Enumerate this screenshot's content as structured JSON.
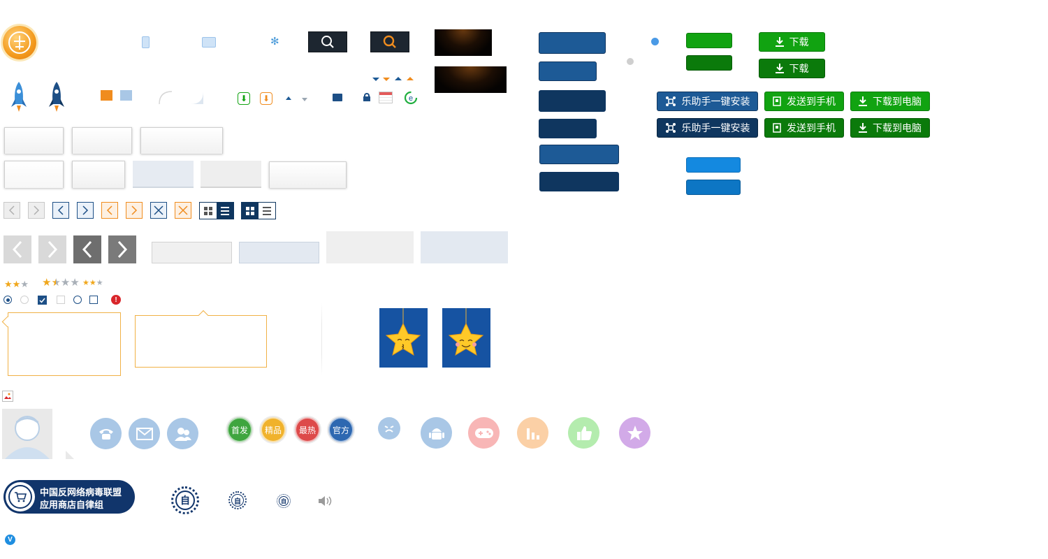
{
  "colors": {
    "navy": "#1d5a96",
    "navy_dark": "#0f365f",
    "green": "#11a311",
    "green_dark": "#0b7a0b",
    "blue_bright": "#1489e0",
    "orange": "#f08c1e",
    "page_bg": "#ffffff"
  },
  "top_icons": {
    "logo": "orange-medal-logo",
    "phone": "mobile-icon",
    "tablet": "tablet-icon",
    "settings": "gear-icon",
    "search": "search-icon"
  },
  "download_buttons": {
    "download_label": "下载",
    "download_label_2": "下载"
  },
  "action_buttons": {
    "install_label": "乐助手一键安装",
    "send_phone_label": "发送到手机",
    "download_pc_label": "下载到电脑",
    "install_label_2": "乐助手一键安装",
    "send_phone_label_2": "发送到手机",
    "download_pc_label_2": "下载到电脑"
  },
  "rating": {
    "small_stars": 2,
    "medium_stars": 1.5,
    "tiny_stars": 2.5,
    "max": 3
  },
  "round_icons": [
    {
      "name": "phone-icon",
      "color": "#a9c7e6"
    },
    {
      "name": "mail-icon",
      "color": "#a9c7e6"
    },
    {
      "name": "users-icon",
      "color": "#a9c7e6"
    }
  ],
  "badges": {
    "first_release": "首发",
    "featured": "精品",
    "hottest": "最热",
    "official": "官方"
  },
  "category_icons": [
    {
      "name": "sad-face-icon",
      "color": "#a9c7e6"
    },
    {
      "name": "android-icon",
      "color": "#a9c7e6"
    },
    {
      "name": "gamepad-icon",
      "color": "#f8b6b6"
    },
    {
      "name": "bar-chart-icon",
      "color": "#fbd0a6"
    },
    {
      "name": "thumbs-up-icon",
      "color": "#b4ecae"
    },
    {
      "name": "star-icon",
      "color": "#d2aae8"
    }
  ],
  "alliance": {
    "line1": "中国反网络病毒联盟",
    "line2": "应用商店自律组",
    "seal_char": "自",
    "seal_char_2": "自",
    "seal_char_3": "自"
  },
  "verified_char": "V"
}
